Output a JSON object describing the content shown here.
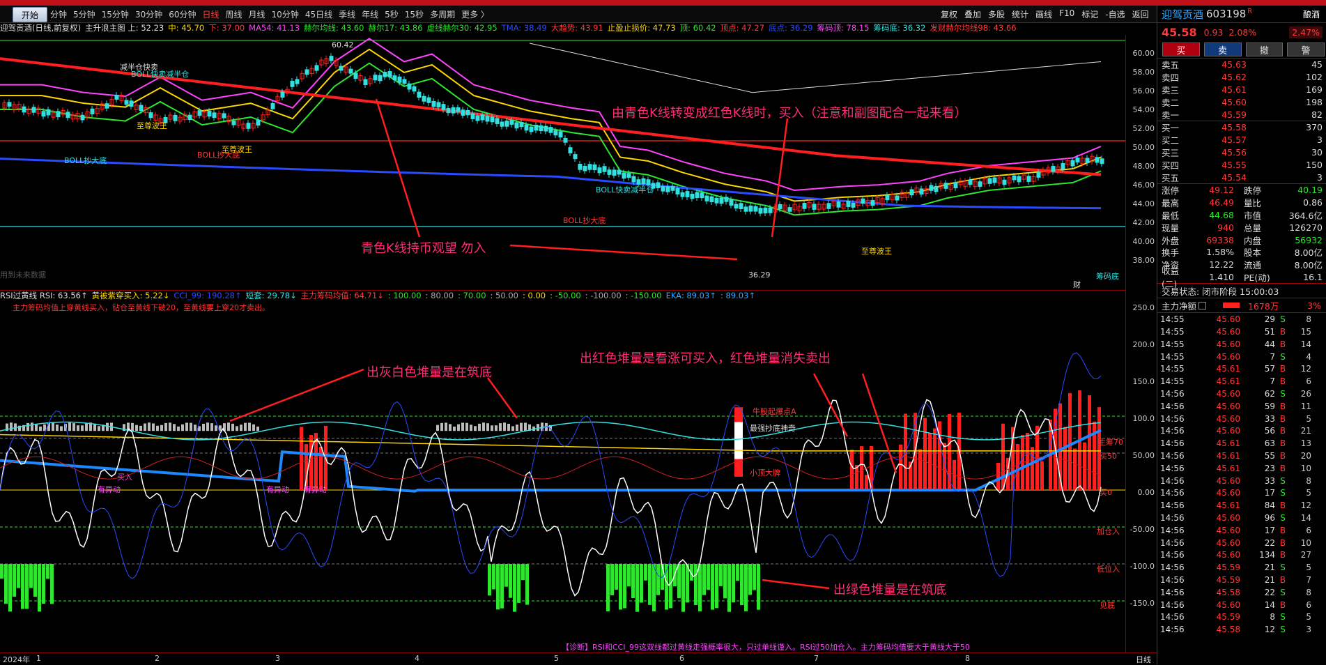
{
  "toolbar": {
    "start": "开始",
    "periods": [
      "分钟",
      "5分钟",
      "15分钟",
      "30分钟",
      "60分钟",
      "日线",
      "周线",
      "月线",
      "10分钟",
      "45日线",
      "季线",
      "年线",
      "5秒",
      "15秒",
      "多周期",
      "更多 〉"
    ],
    "active_period": "日线",
    "right": [
      "复权",
      "叠加",
      "多股",
      "统计",
      "画线",
      "F10",
      "标记",
      "-自选",
      "返回"
    ]
  },
  "main_indicators": [
    {
      "t": "迎驾贡酒(日线,前复权)",
      "c": "#dddddd"
    },
    {
      "t": "主升浪主图 上: 52.23",
      "c": "#dddddd"
    },
    {
      "t": "中: 45.70",
      "c": "#ffd700"
    },
    {
      "t": "下: 37.00",
      "c": "#ff3a3a"
    },
    {
      "t": "MA54: 41.13",
      "c": "#ff44ff"
    },
    {
      "t": "赫尔均线: 43.60",
      "c": "#2ee62e"
    },
    {
      "t": "赫尔17: 43.86",
      "c": "#2ee62e"
    },
    {
      "t": "虚线赫尔30: 42.95",
      "c": "#2ee62e"
    },
    {
      "t": "TMA: 38.49",
      "c": "#2a4bff"
    },
    {
      "t": "大趋势: 43.91",
      "c": "#ff3a3a"
    },
    {
      "t": "止盈止损价: 47.73",
      "c": "#ffd700"
    },
    {
      "t": "顶: 60.42",
      "c": "#2ee62e"
    },
    {
      "t": "顶点: 47.27",
      "c": "#ff3a3a"
    },
    {
      "t": "底点: 36.29",
      "c": "#2a4bff"
    },
    {
      "t": "筹码顶: 78.15",
      "c": "#ff44ff"
    },
    {
      "t": "筹码底: 36.32",
      "c": "#33e0e0"
    },
    {
      "t": "发财赫尔均线98: 43.66",
      "c": "#ff3a3a"
    }
  ],
  "sub_indicators": [
    {
      "t": "RSI过黄线 RSI: 63.56↑",
      "c": "#dddddd"
    },
    {
      "t": "黄被紫穿买入: 5.22↓",
      "c": "#ffd700"
    },
    {
      "t": "CCI_99: 190.28↑",
      "c": "#2a4bff"
    },
    {
      "t": "短套: 29.78↓",
      "c": "#33e0e0"
    },
    {
      "t": "主力筹码均值: 64.71↓",
      "c": "#ff3a3a"
    },
    {
      "t": ": 100.00",
      "c": "#2ee62e"
    },
    {
      "t": ": 80.00",
      "c": "#aaaaaa"
    },
    {
      "t": ": 70.00",
      "c": "#2ee62e"
    },
    {
      "t": ": 50.00",
      "c": "#aaaaaa"
    },
    {
      "t": ": 0.00",
      "c": "#ffd700"
    },
    {
      "t": ": -50.00",
      "c": "#2ee62e"
    },
    {
      "t": ": -100.00",
      "c": "#aaaaaa"
    },
    {
      "t": ": -150.00",
      "c": "#2ee62e"
    },
    {
      "t": "EKA: 89.03↑",
      "c": "#33aaff"
    },
    {
      "t": ": 89.03↑",
      "c": "#33aaff"
    }
  ],
  "sub_note": "主力筹码均值上穿黄线买入，钻仓至黄线下破20，至黄线要上穿20才卖出。",
  "main_axis": [
    "60.00",
    "58.00",
    "56.00",
    "54.00",
    "52.00",
    "50.00",
    "48.00",
    "46.00",
    "44.00",
    "42.00",
    "40.00",
    "38.00"
  ],
  "sub_axis": [
    "250.0",
    "200.0",
    "150.0",
    "100.0",
    "50.00",
    "0.00",
    "-50.00",
    "-100.0",
    "-150.0"
  ],
  "x_labels": [
    "2024年",
    "1",
    "2",
    "3",
    "4",
    "5",
    "6",
    "7",
    "8"
  ],
  "bottom_right": "日线",
  "annotations": {
    "a1": "由青色K线转变成红色K线时，买入（注意和副图配合一起来看）",
    "a2": "青色K线持币观望 勿入",
    "a3": "出灰白色堆量是在筑底",
    "a4": "出红色堆量是看涨可买入，红色堆量消失卖出",
    "a5": "出绿色堆量是在筑底",
    "diag": "【诊断】RSI和CCI_99这双线都过黄线走强概率很大，只过单线谨入。RSI过50加仓入。主力筹码均值要大于黄线大于50"
  },
  "chart_labels": {
    "boll_low1": "BOLL抄大底",
    "boll_low2": "BOLL抄大底",
    "boll_low3": "BOLL抄大底",
    "boll_fast": "BOLL快卖减半仓",
    "boll_fast2": "BOLL快卖减半仓",
    "half": "减半仓快卖",
    "wave1": "至尊波王",
    "wave2": "至尊波王",
    "wave3": "至尊波王",
    "top": "60.42",
    "bottom": "36.29",
    "chip_bottom": "筹码底",
    "cai": "财",
    "buy_dot": "买入",
    "nodata": "用到未来数据",
    "niu": "牛股起爆点A",
    "strong": "最强抄底神奇",
    "small": "小顶大牌",
    "main_r1": "主筹70",
    "main_r2": "买50",
    "main_r3": "买0",
    "add": "加仓入",
    "low": "低位入",
    "see": "见底",
    "abn1": "有异动",
    "abn2": "有异动",
    "abn3": "有异动"
  },
  "quote": {
    "name": "迎驾贡酒",
    "code": "603198",
    "tag": "R",
    "sector": "酿酒",
    "price": "45.58",
    "chg": "0.93",
    "pct": "2.08%",
    "pct_box": "2.47%",
    "buttons": [
      "买",
      "卖",
      "撤",
      "警"
    ],
    "asks": [
      [
        "卖五",
        "45.63",
        "45"
      ],
      [
        "卖四",
        "45.62",
        "102"
      ],
      [
        "卖三",
        "45.61",
        "169"
      ],
      [
        "卖二",
        "45.60",
        "198"
      ],
      [
        "卖一",
        "45.59",
        "82"
      ]
    ],
    "bids": [
      [
        "买一",
        "45.58",
        "370"
      ],
      [
        "买二",
        "45.57",
        "3"
      ],
      [
        "买三",
        "45.56",
        "30"
      ],
      [
        "买四",
        "45.55",
        "150"
      ],
      [
        "买五",
        "45.54",
        "3"
      ]
    ],
    "stats": [
      [
        "涨停",
        "49.12",
        "up",
        "跌停",
        "40.19",
        "dn"
      ],
      [
        "最高",
        "46.49",
        "up",
        "量比",
        "0.86",
        "wh"
      ],
      [
        "最低",
        "44.68",
        "dn",
        "市值",
        "364.6亿",
        "wh"
      ],
      [
        "现量",
        "940",
        "up",
        "总量",
        "126270",
        "wh"
      ],
      [
        "外盘",
        "69338",
        "up",
        "内盘",
        "56932",
        "dn"
      ],
      [
        "换手",
        "1.58%",
        "wh",
        "股本",
        "8.00亿",
        "wh"
      ],
      [
        "净资",
        "12.22",
        "wh",
        "流通",
        "8.00亿",
        "wh"
      ],
      [
        "收益(二)",
        "1.410",
        "wh",
        "PE(动)",
        "16.1",
        "wh"
      ]
    ],
    "status": "交易状态: 闭市阶段 15:00:03",
    "net_label": "主力净额",
    "net_value": "1678万",
    "net_pct": "3%",
    "ticks": [
      [
        "14:55",
        "45.60",
        "29",
        "S",
        "8"
      ],
      [
        "14:55",
        "45.60",
        "51",
        "B",
        "15"
      ],
      [
        "14:55",
        "45.60",
        "44",
        "B",
        "14"
      ],
      [
        "14:55",
        "45.60",
        "7",
        "S",
        "4"
      ],
      [
        "14:55",
        "45.61",
        "57",
        "B",
        "12"
      ],
      [
        "14:55",
        "45.61",
        "7",
        "B",
        "6"
      ],
      [
        "14:56",
        "45.60",
        "62",
        "S",
        "26"
      ],
      [
        "14:56",
        "45.60",
        "59",
        "B",
        "11"
      ],
      [
        "14:56",
        "45.60",
        "33",
        "B",
        "5"
      ],
      [
        "14:56",
        "45.60",
        "56",
        "B",
        "21"
      ],
      [
        "14:56",
        "45.61",
        "63",
        "B",
        "13"
      ],
      [
        "14:56",
        "45.61",
        "55",
        "B",
        "20"
      ],
      [
        "14:56",
        "45.61",
        "23",
        "B",
        "10"
      ],
      [
        "14:56",
        "45.60",
        "33",
        "S",
        "8"
      ],
      [
        "14:56",
        "45.60",
        "17",
        "S",
        "5"
      ],
      [
        "14:56",
        "45.61",
        "84",
        "B",
        "12"
      ],
      [
        "14:56",
        "45.60",
        "96",
        "S",
        "14"
      ],
      [
        "14:56",
        "45.60",
        "17",
        "B",
        "6"
      ],
      [
        "14:56",
        "45.60",
        "22",
        "B",
        "10"
      ],
      [
        "14:56",
        "45.60",
        "134",
        "B",
        "27"
      ],
      [
        "14:56",
        "45.59",
        "21",
        "S",
        "5"
      ],
      [
        "14:56",
        "45.59",
        "21",
        "B",
        "7"
      ],
      [
        "14:56",
        "45.58",
        "22",
        "S",
        "8"
      ],
      [
        "14:56",
        "45.60",
        "14",
        "B",
        "6"
      ],
      [
        "14:56",
        "45.59",
        "8",
        "S",
        "5"
      ],
      [
        "14:56",
        "45.58",
        "12",
        "S",
        "3"
      ]
    ]
  }
}
